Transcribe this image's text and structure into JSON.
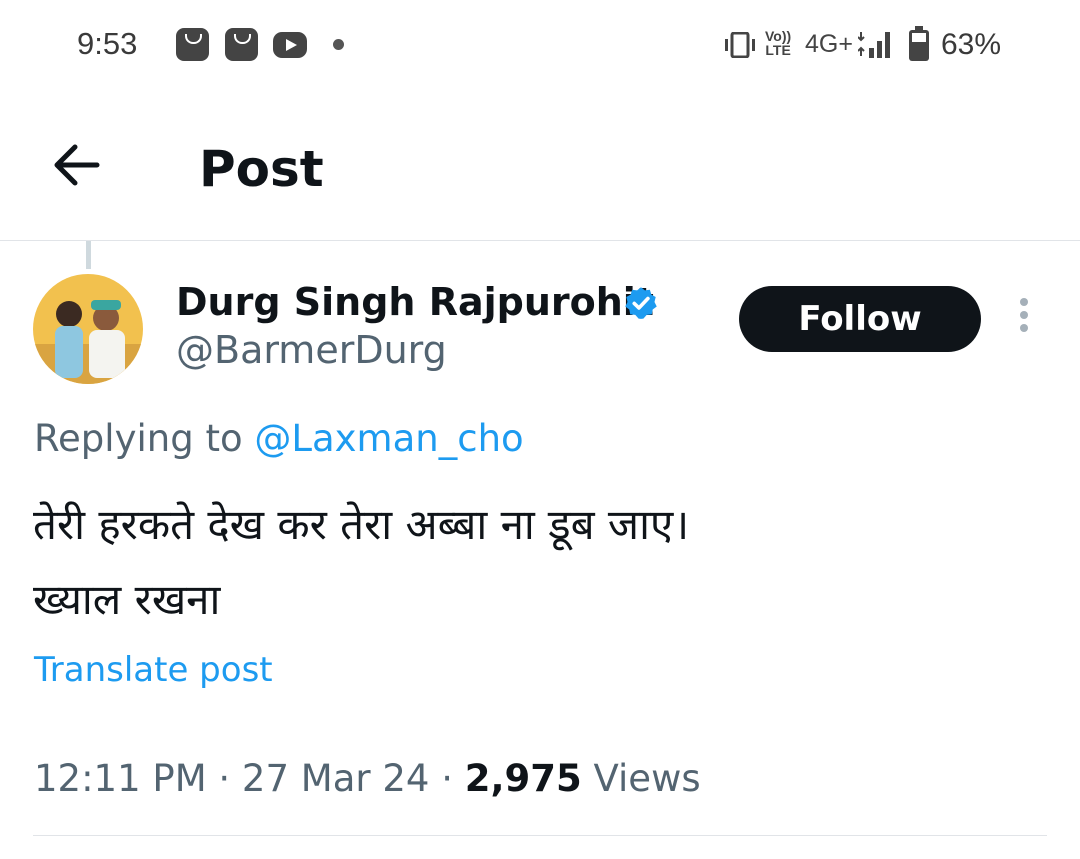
{
  "status_bar": {
    "time": "9:53",
    "notification_icons": [
      "shopping-bag-icon",
      "shopping-bag-icon",
      "youtube-icon",
      "dot-icon"
    ],
    "volte_top": "Vo))",
    "volte_bottom": "LTE",
    "network": "4G+",
    "battery_percent": "63%"
  },
  "header": {
    "back_icon": "arrow-left-icon",
    "title": "Post"
  },
  "post": {
    "author_name": "Durg Singh Rajpurohit",
    "author_handle": "@BarmerDurg",
    "verified_icon": "verified-badge-icon",
    "follow_label": "Follow",
    "more_icon": "more-vertical-icon",
    "replying_prefix": "Replying to",
    "replying_to": "@Laxman_cho",
    "text_line_1": "तेरी हरकते देख कर तेरा अब्बा ना डूब जाए।",
    "text_line_2": "ख्याल रखना",
    "translate_label": "Translate post",
    "time": "12:11 PM",
    "date": "27 Mar 24",
    "separator": "·",
    "views_count": "2,975",
    "views_label": "Views"
  },
  "colors": {
    "accent": "#1d9bf0",
    "text_primary": "#0f1419",
    "text_secondary": "#536471",
    "button_bg": "#0f1419"
  }
}
